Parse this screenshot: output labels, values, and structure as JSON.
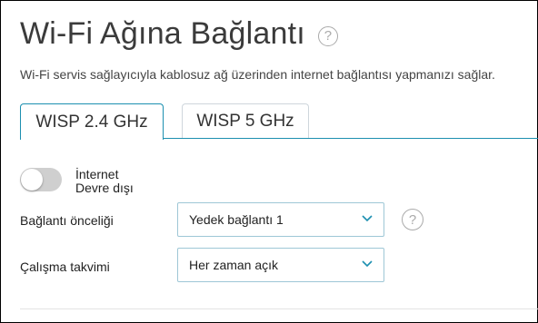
{
  "header": {
    "title": "Wi-Fi Ağına Bağlantı",
    "help_glyph": "?",
    "description": "Wi-Fi servis sağlayıcıyla kablosuz ağ üzerinden internet bağlantısı yapmanızı sağlar."
  },
  "tabs": [
    {
      "label": "WISP 2.4 GHz",
      "active": true
    },
    {
      "label": "WISP 5 GHz",
      "active": false
    }
  ],
  "internet": {
    "label": "İnternet",
    "status": "Devre dışı",
    "enabled": false
  },
  "priority": {
    "label": "Bağlantı önceliği",
    "value": "Yedek bağlantı 1",
    "help_glyph": "?"
  },
  "schedule": {
    "label": "Çalışma takvimi",
    "value": "Her zaman açık"
  },
  "colors": {
    "accent": "#1c8fb0",
    "toggle_off": "#cfcfcf"
  },
  "icons": [
    "help-icon",
    "chevron-down-icon"
  ]
}
